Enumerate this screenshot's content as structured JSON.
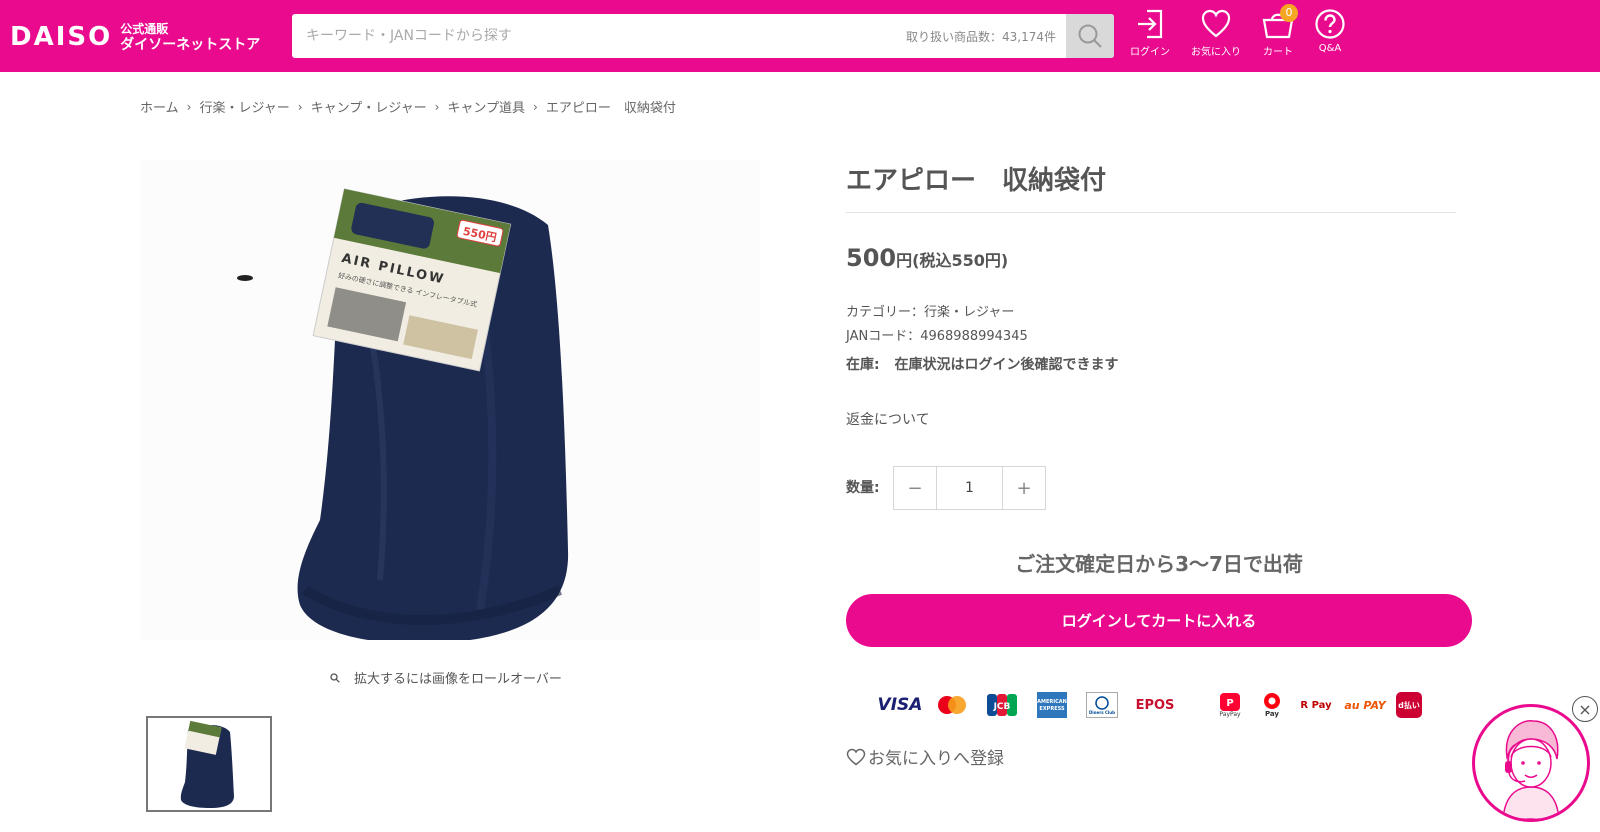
{
  "header": {
    "logo_text": "DAISO",
    "logo_sub1": "公式通販",
    "logo_sub2": "ダイソーネットストア",
    "search_placeholder": "キーワード・JANコードから探す",
    "search_count": "取り扱い商品数：43,174件",
    "nav": {
      "login": "ログイン",
      "favorites": "お気に入り",
      "cart": "カート",
      "cart_count": "0",
      "qa": "Q&A"
    },
    "colors": {
      "brand": "#ea0a8e",
      "badge": "#f5a623"
    }
  },
  "breadcrumb": [
    "ホーム",
    "行楽・レジャー",
    "キャンプ・レジャー",
    "キャンプ道具",
    "エアピロー　収納袋付"
  ],
  "product": {
    "title": "エアピロー　収納袋付",
    "price": "500",
    "price_unit": "円",
    "price_tax": "(税込550円)",
    "category": "カテゴリー：行楽・レジャー",
    "jan": "JANコード：4968988994345",
    "stock_label": "在庫:",
    "stock_text": "在庫状況はログイン後確認できます",
    "refund": "返金について",
    "qty_label": "数量:",
    "qty_value": "1",
    "shipping": "ご注文確定日から3〜7日で出荷",
    "cart_button": "ログインしてカートに入れる",
    "favorite": "お気に入りへ登録",
    "zoom_hint": "拡大するには画像をロールオーバー",
    "package_price": "550円",
    "package_label": "AIR PILLOW",
    "package_tagline": "好みの硬さに調整できる インフレータブル式"
  },
  "payments": [
    "VISA",
    "Mastercard",
    "JCB",
    "AMERICAN EXPRESS",
    "Diners Club",
    "EPOS",
    "PayPay",
    "Pay",
    "R Pay",
    "au PAY",
    "d払い"
  ],
  "payment_labels": {
    "paypay": "PayPay",
    "merpay": "Pay",
    "rpay": "R Pay",
    "aupay": "au PAY",
    "dpay": "d払い"
  }
}
